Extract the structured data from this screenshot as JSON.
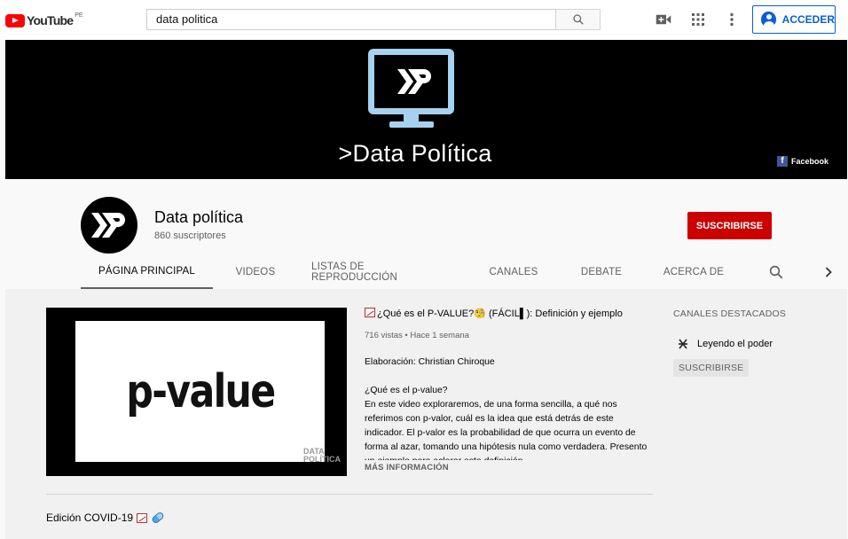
{
  "masthead": {
    "logo_text": "YouTube",
    "country_code": "PE",
    "search_value": "data politica",
    "signin_label": "ACCEDER"
  },
  "banner": {
    "title": ">Data Política",
    "facebook_label": "Facebook"
  },
  "channel": {
    "name": "Data política",
    "subscribers": "860 suscriptores",
    "subscribe_label": "SUSCRIBIRSE"
  },
  "tabs": [
    {
      "label": "PÁGINA PRINCIPAL",
      "active": true
    },
    {
      "label": "VIDEOS"
    },
    {
      "label": "LISTAS DE REPRODUCCIÓN"
    },
    {
      "label": "CANALES"
    },
    {
      "label": "DEBATE"
    },
    {
      "label": "ACERCA DE"
    }
  ],
  "featured_video": {
    "thumbnail_text": "p-value",
    "thumbnail_watermark_1": "DATA",
    "thumbnail_watermark_2": "POLÍTICA",
    "title": "¿Qué es el P-VALUE?🧐 (FÁCIL▌): Definición y ejemplo",
    "meta": "716 vistas • Hace 1 semana",
    "credit": "Elaboración: Christian Chiroque",
    "question": "¿Qué es el p-value?",
    "description": "En este video exploraremos, de una forma sencilla, a qué nos referimos con p-valor, cuál es la idea que está detrás de este indicador. El p-valor es la probabilidad de que ocurra un evento de forma al azar, tomando una hipótesis nula como verdadera. Presento un ejemplo para aclarar esta definición.",
    "more_label": "MÁS INFORMACIÓN"
  },
  "section": {
    "title": "Edición COVID-19"
  },
  "featured_channels": {
    "heading": "CANALES DESTACADOS",
    "items": [
      {
        "name": "Leyendo el poder",
        "subscribe_label": "SUSCRIBIRSE"
      }
    ]
  },
  "colors": {
    "subscribe_red": "#cc0000",
    "accent_blue": "#065fd4",
    "banner_monitor": "#a6d1f0"
  }
}
